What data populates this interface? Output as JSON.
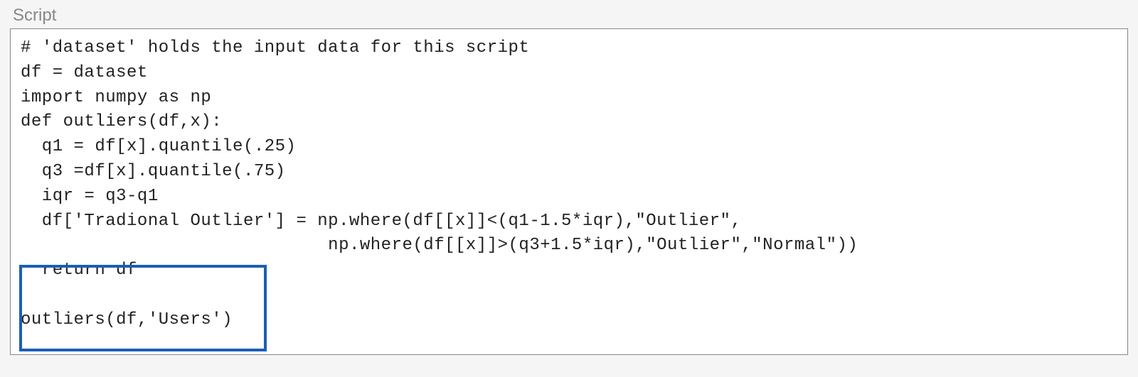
{
  "label": "Script",
  "code": {
    "line1": "# 'dataset' holds the input data for this script",
    "line2": "df = dataset",
    "line3": "import numpy as np",
    "line4": "def outliers(df,x):",
    "line5": "  q1 = df[x].quantile(.25)",
    "line6": "  q3 =df[x].quantile(.75)",
    "line7": "  iqr = q3-q1",
    "line8": "  df['Tradional Outlier'] = np.where(df[[x]]<(q1-1.5*iqr),\"Outlier\",",
    "line9": "                             np.where(df[[x]]>(q3+1.5*iqr),\"Outlier\",\"Normal\"))",
    "line10": "  return df",
    "line11": "",
    "line12": "outliers(df,'Users')"
  }
}
